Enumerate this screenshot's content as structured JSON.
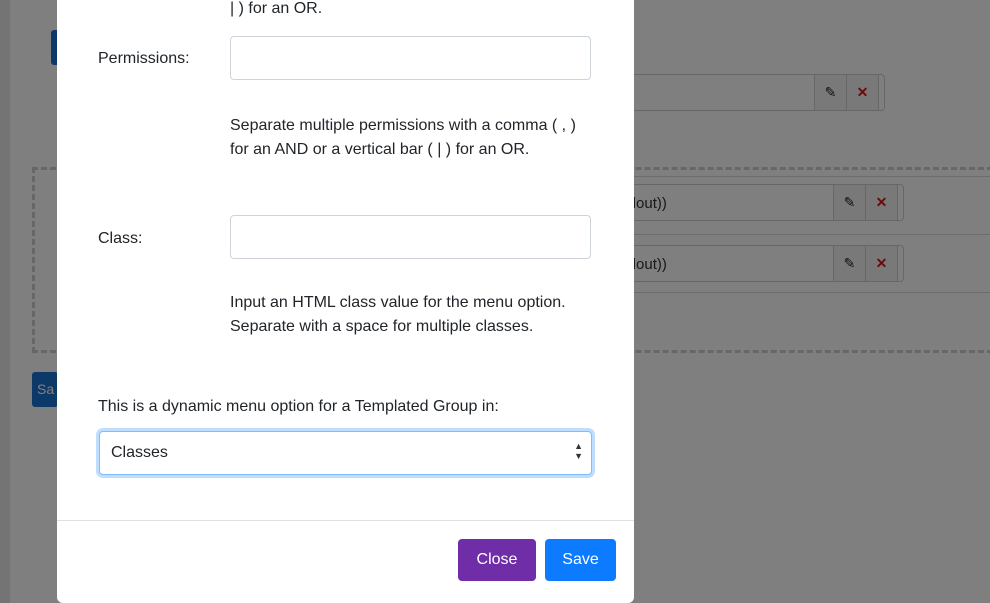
{
  "background": {
    "rows": [
      {
        "text": ""
      },
      {
        "text": "andout))"
      },
      {
        "text": "andout))"
      }
    ],
    "partial_button_label": "Sa"
  },
  "modal": {
    "cut_off_text": "| ) for an OR.",
    "permissions": {
      "label": "Permissions:",
      "value": "",
      "help": "Separate multiple permissions with a comma ( , ) for an AND or a vertical bar ( | ) for an OR."
    },
    "class": {
      "label": "Class:",
      "value": "",
      "help": "Input an HTML class value for the menu option. Separate with a space for multiple classes."
    },
    "dynamic_label": "This is a dynamic menu option for a Templated Group in:",
    "group_select": {
      "selected": "Classes"
    },
    "footer": {
      "close_label": "Close",
      "save_label": "Save"
    }
  },
  "colors": {
    "close_button": "#6f2da8",
    "save_button": "#0d7bff",
    "delete_icon": "#d01818"
  }
}
